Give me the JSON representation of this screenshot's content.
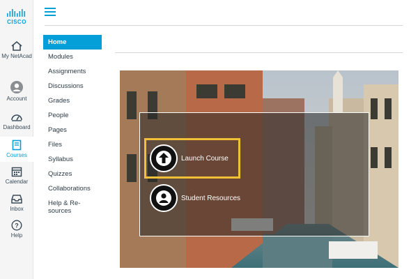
{
  "brand": {
    "logo_text": "CISCO"
  },
  "global_nav": [
    {
      "key": "my-netacad",
      "label": "My NetAcad",
      "icon": "home-icon",
      "active": false
    },
    {
      "key": "account",
      "label": "Account",
      "icon": "user-icon",
      "active": false
    },
    {
      "key": "dashboard",
      "label": "Dashboard",
      "icon": "dashboard-icon",
      "active": false
    },
    {
      "key": "courses",
      "label": "Courses",
      "icon": "book-icon",
      "active": true
    },
    {
      "key": "calendar",
      "label": "Calendar",
      "icon": "calendar-icon",
      "active": false
    },
    {
      "key": "inbox",
      "label": "Inbox",
      "icon": "inbox-icon",
      "active": false
    },
    {
      "key": "help",
      "label": "Help",
      "icon": "help-icon",
      "active": false
    }
  ],
  "course_nav": [
    {
      "label": "Home",
      "active": true
    },
    {
      "label": "Modules"
    },
    {
      "label": "Assignments"
    },
    {
      "label": "Discussions"
    },
    {
      "label": "Grades"
    },
    {
      "label": "People"
    },
    {
      "label": "Pages"
    },
    {
      "label": "Files"
    },
    {
      "label": "Syllabus"
    },
    {
      "label": "Quizzes"
    },
    {
      "label": "Collaborations"
    },
    {
      "label": "Help & Re-sources"
    }
  ],
  "hero": {
    "launch_label": "Launch Course",
    "launch_icon": "arrow-up-icon",
    "resources_label": "Student Resources",
    "resources_icon": "person-icon"
  },
  "colors": {
    "accent": "#049fd9",
    "highlight": "#f2c037"
  }
}
